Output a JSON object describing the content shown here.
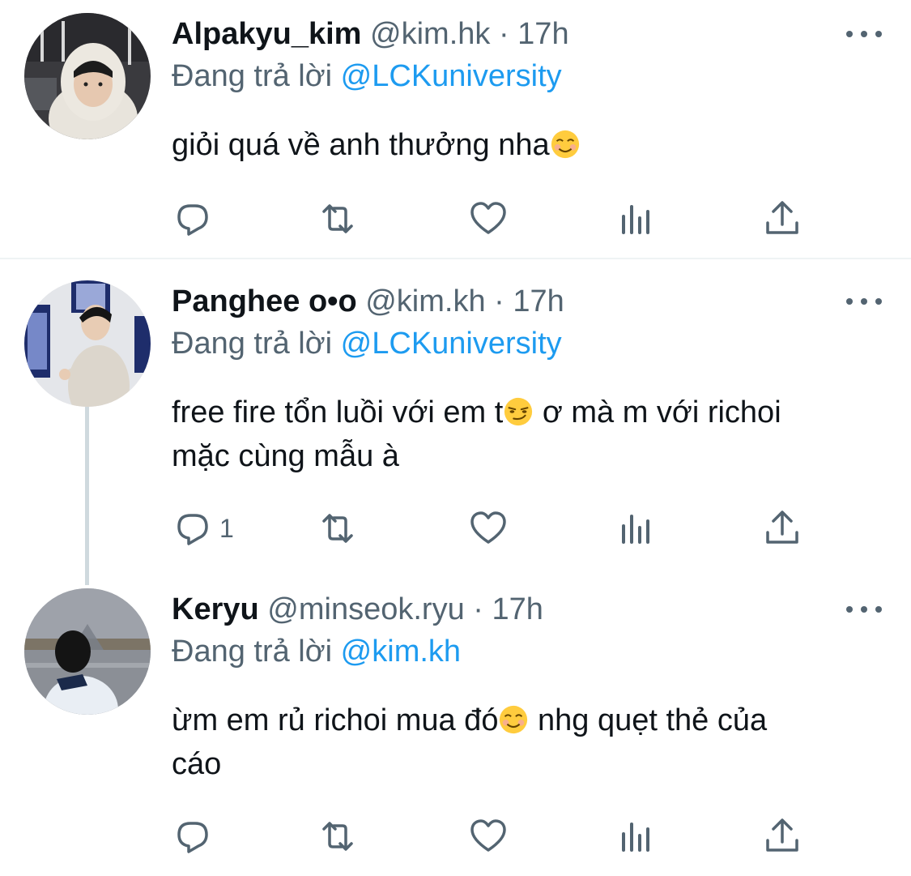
{
  "tweets": [
    {
      "name": "Alpakyu_kim",
      "handle": "@kim.hk",
      "separator": "·",
      "time": "17h",
      "replying_prefix": "Đang trả lời ",
      "replying_to": "@LCKuniversity",
      "body_text": "giỏi quá về anh thưởng nha",
      "emoji": "smiling-face-emoji",
      "reply_count": "",
      "icons": [
        "reply-icon",
        "retweet-icon",
        "like-icon",
        "analytics-icon",
        "share-icon"
      ]
    },
    {
      "name": "Panghee o•o",
      "handle": "@kim.kh",
      "separator": "·",
      "time": "17h",
      "replying_prefix": "Đang trả lời ",
      "replying_to": "@LCKuniversity",
      "body_text_1": "free fire tổn luồi với em t",
      "body_text_2": " ơ mà m với richoi",
      "body_text_3": "mặc cùng mẫu à",
      "emoji": "smirking-face-emoji",
      "reply_count": "1",
      "icons": [
        "reply-icon",
        "retweet-icon",
        "like-icon",
        "analytics-icon",
        "share-icon"
      ]
    },
    {
      "name": "Keryu",
      "handle": "@minseok.ryu",
      "separator": "·",
      "time": "17h",
      "replying_prefix": "Đang trả lời ",
      "replying_to": "@kim.kh",
      "body_text_1": "ừm em rủ richoi mua đó",
      "body_text_2": " nhg quẹt thẻ của",
      "body_text_3": "cáo",
      "emoji": "smiling-face-emoji",
      "reply_count": "",
      "icons": [
        "reply-icon",
        "retweet-icon",
        "like-icon",
        "analytics-icon",
        "share-icon"
      ]
    }
  ],
  "colors": {
    "text": "#0f1419",
    "secondary": "#536471",
    "accent": "#1d9bf0",
    "divider": "#eff3f4",
    "thread_line": "#cfd9de"
  }
}
